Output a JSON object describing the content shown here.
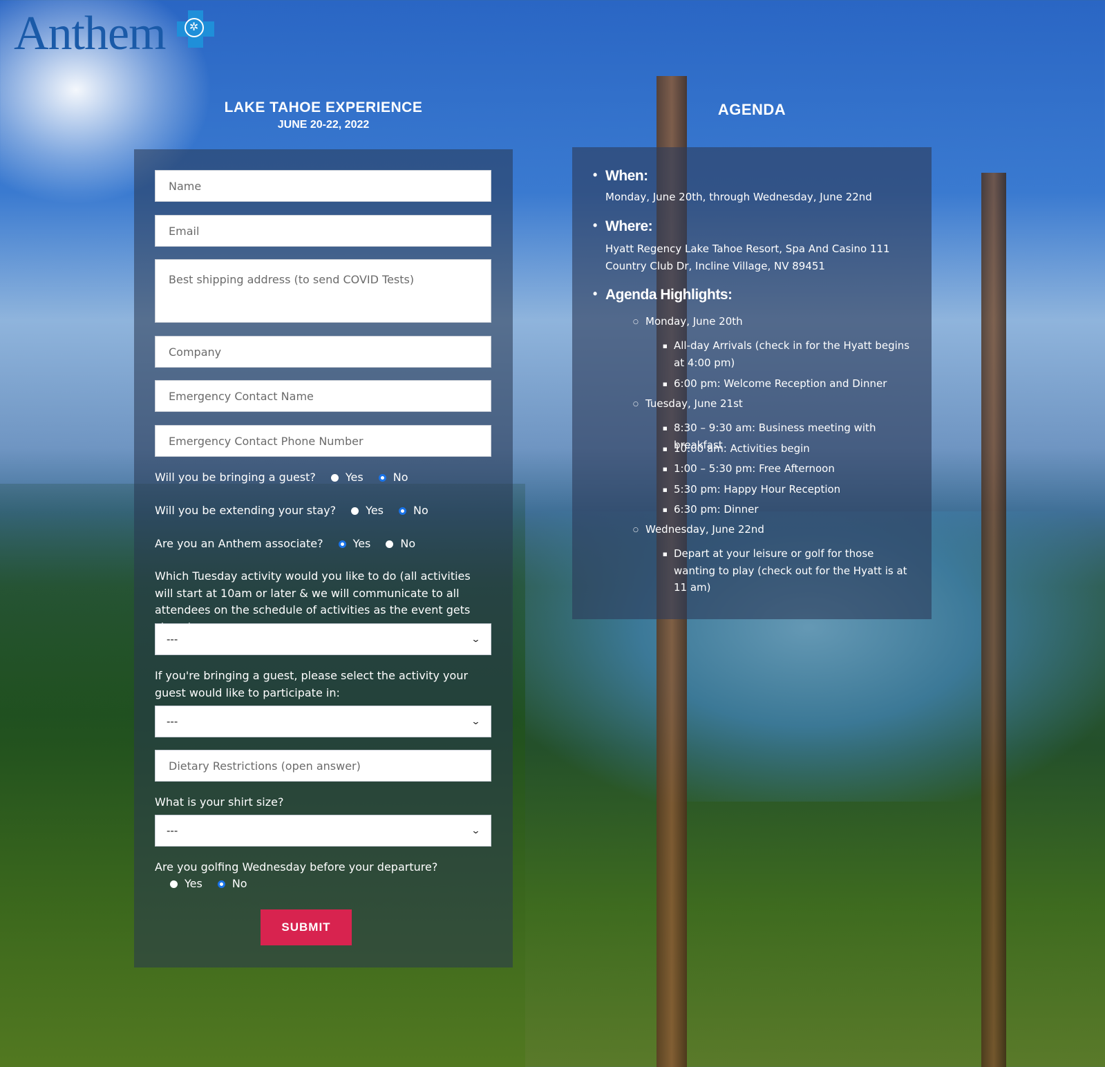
{
  "logo": {
    "text": "Anthem"
  },
  "event": {
    "title": "LAKE TAHOE EXPERIENCE",
    "dates": "JUNE 20-22, 2022"
  },
  "form": {
    "name_placeholder": "Name",
    "email_placeholder": "Email",
    "address_placeholder": "Best shipping address (to send COVID Tests)",
    "company_placeholder": "Company",
    "emergency_name_placeholder": "Emergency Contact Name",
    "emergency_phone_placeholder": "Emergency Contact Phone Number",
    "guest": {
      "question": "Will you be bringing a guest?",
      "yes": "Yes",
      "no": "No",
      "selected": "No"
    },
    "extend": {
      "question": "Will you be extending your stay?",
      "yes": "Yes",
      "no": "No",
      "selected": "No"
    },
    "associate": {
      "question": "Are you an Anthem associate?",
      "yes": "Yes",
      "no": "No",
      "selected": "Yes"
    },
    "tuesday_activity": {
      "question": "Which Tuesday activity would you like to do (all activities will start at 10am or later & we will communicate to all attendees on the schedule of activities as the event gets closer):",
      "selected": "---"
    },
    "guest_activity": {
      "question": "If you're bringing a guest, please select the activity your guest would like to participate in:",
      "selected": "---"
    },
    "dietary_placeholder": "Dietary Restrictions (open answer)",
    "shirt": {
      "question": "What is your shirt size?",
      "selected": "---"
    },
    "golf": {
      "question": "Are you golfing Wednesday before your departure?",
      "yes": "Yes",
      "no": "No",
      "selected": "No"
    },
    "submit_label": "SUBMIT"
  },
  "agenda": {
    "title": "AGENDA",
    "when_label": "When:",
    "when_text": "Monday, June 20th, through Wednesday, June 22nd",
    "where_label": "Where:",
    "where_line1": "Hyatt Regency Lake Tahoe Resort, Spa And Casino 111",
    "where_line2": "Country Club Dr, Incline Village, NV 89451",
    "highlights_label": "Agenda Highlights:",
    "days": [
      {
        "day": "Monday, June 20th",
        "items": [
          "All-day Arrivals (check in for the Hyatt begins at 4:00 pm)",
          "6:00 pm: Welcome Reception and Dinner"
        ]
      },
      {
        "day": "Tuesday, June 21st",
        "items": [
          "8:30 – 9:30 am: Business meeting with breakfast",
          "10:00 am: Activities begin",
          "1:00 – 5:30 pm: Free Afternoon",
          "5:30 pm: Happy Hour Reception",
          "6:30 pm: Dinner"
        ]
      },
      {
        "day": "Wednesday, June 22nd",
        "items": [
          "Depart at your leisure or golf for those wanting to play (check out for the Hyatt is at 11 am)"
        ]
      }
    ]
  },
  "colors": {
    "brand_blue": "#1a5aa8",
    "submit_red": "#d8234f",
    "radio_blue": "#1a73e8"
  }
}
